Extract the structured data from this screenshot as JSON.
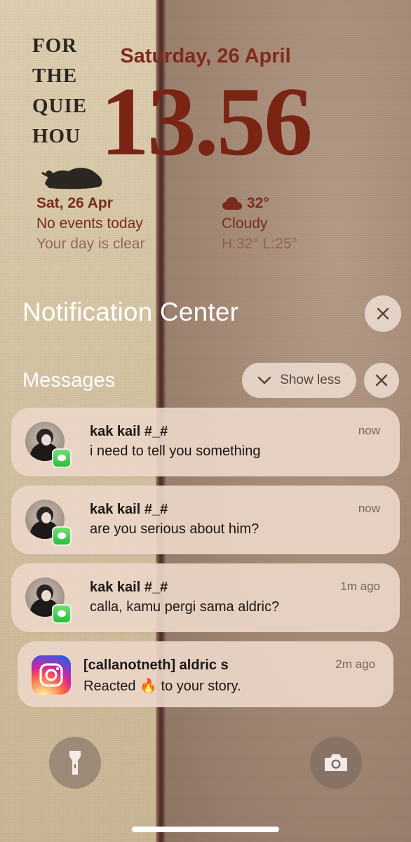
{
  "wallpaper": {
    "book_title_lines": [
      "FOR",
      "THE",
      "QUIE",
      "HOU"
    ]
  },
  "lockscreen": {
    "date": "Saturday, 26 April",
    "time": "13.56"
  },
  "calendar_widget": {
    "date": "Sat, 26 Apr",
    "events": "No events today",
    "subtitle": "Your day is clear"
  },
  "weather_widget": {
    "icon": "cloud-icon",
    "temperature": "32°",
    "condition": "Cloudy",
    "range": "H:32° L:25°"
  },
  "notification_center": {
    "title": "Notification Center",
    "group_title": "Messages",
    "show_less_label": "Show less",
    "notifications": [
      {
        "sender": "kak kail #_#",
        "body": "i need to tell you something",
        "time": "now",
        "app": "messages"
      },
      {
        "sender": "kak kail #_#",
        "body": "are you serious about him?",
        "time": "now",
        "app": "messages"
      },
      {
        "sender": "kak kail #_#",
        "body": "calla, kamu pergi sama aldric?",
        "time": "1m ago",
        "app": "messages"
      },
      {
        "sender": "[callanotneth] aldric s",
        "body": "Reacted 🔥 to your story.",
        "time": "2m ago",
        "app": "instagram"
      }
    ]
  },
  "bottom_controls": {
    "left": "flashlight-icon",
    "right": "camera-icon"
  },
  "colors": {
    "accent_text": "#7a2414",
    "notification_bg": "#ecd6c8",
    "messages_badge": "#2dbd3b"
  }
}
